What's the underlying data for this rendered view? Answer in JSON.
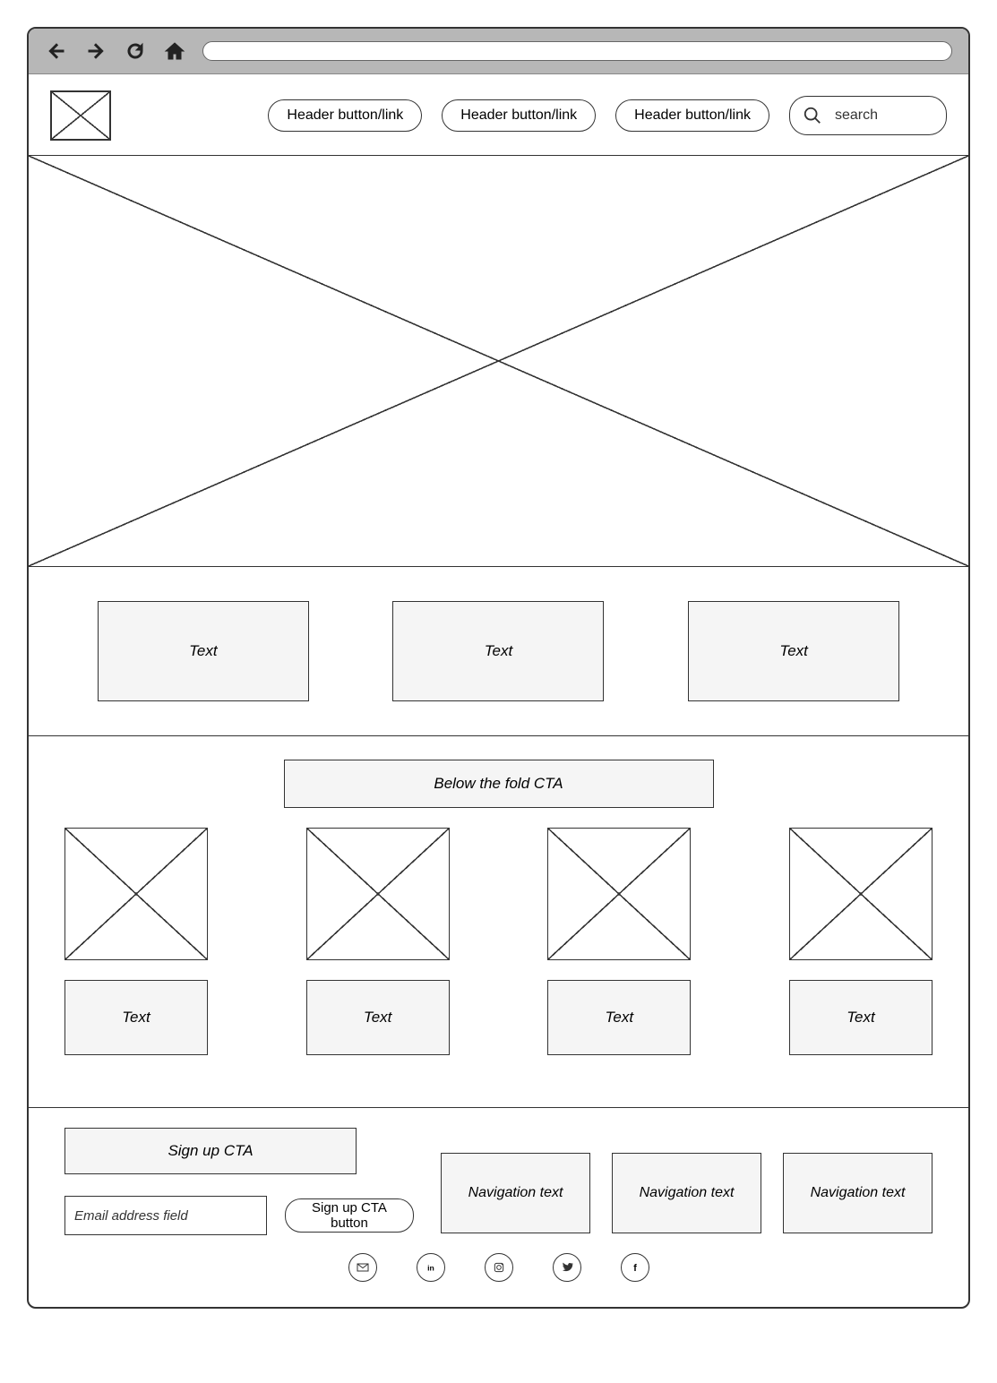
{
  "header": {
    "nav_links": [
      "Header button/link",
      "Header button/link",
      "Header button/link"
    ],
    "search_label": "search"
  },
  "three_up": [
    "Text",
    "Text",
    "Text"
  ],
  "fold_cta": "Below the fold CTA",
  "four_up_text": [
    "Text",
    "Text",
    "Text",
    "Text"
  ],
  "footer": {
    "signup_cta": "Sign up CTA",
    "email_placeholder": "Email address field",
    "signup_button": "Sign up CTA button",
    "nav_cards": [
      "Navigation text",
      "Navigation text",
      "Navigation text"
    ]
  },
  "social": [
    "mail",
    "linkedin",
    "instagram",
    "twitter",
    "facebook"
  ]
}
